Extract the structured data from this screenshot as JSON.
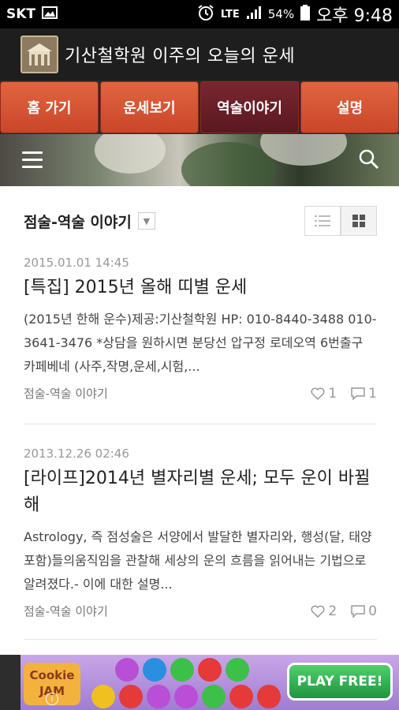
{
  "status_bar": {
    "carrier": "SKT",
    "network": "LTE",
    "battery": "54%",
    "time": "오후 9:48"
  },
  "app": {
    "title": "기산철학원 이주의 오늘의 운세"
  },
  "tabs": [
    {
      "label": "홈 가기",
      "active": false
    },
    {
      "label": "운세보기",
      "active": false
    },
    {
      "label": "역술이야기",
      "active": true
    },
    {
      "label": "설명",
      "active": false
    }
  ],
  "list": {
    "title": "점술-역술 이야기"
  },
  "posts": [
    {
      "date": "2015.01.01 14:45",
      "title": "[특집] 2015년 올해 띠별 운세",
      "excerpt": "(2015년 한해 운수)제공:기산철학원 HP: 010-8440-3488 010-3641-3476 *상담을 원하시면 분당선 압구정 로데오역 6번출구 카페베네 (사주,작명,운세,시험,...",
      "category": "점술-역술 이야기",
      "likes": "1",
      "comments": "1"
    },
    {
      "date": "2013.12.26 02:46",
      "title": "[라이프]2014년 별자리별 운세; 모두 운이 바뀔 해",
      "excerpt": "Astrology, 즉 점성술은 서양에서 발달한 별자리와, 행성(달, 태양 포함)들의움직임을 관찰해 세상의 운의 흐름을 읽어내는 기법으로 알려졌다.- 이에 대한 설명...",
      "category": "점술-역술 이야기",
      "likes": "2",
      "comments": "0"
    }
  ],
  "ad": {
    "brand": "Cookie JAM",
    "cta": "PLAY FREE!",
    "info": "i"
  }
}
